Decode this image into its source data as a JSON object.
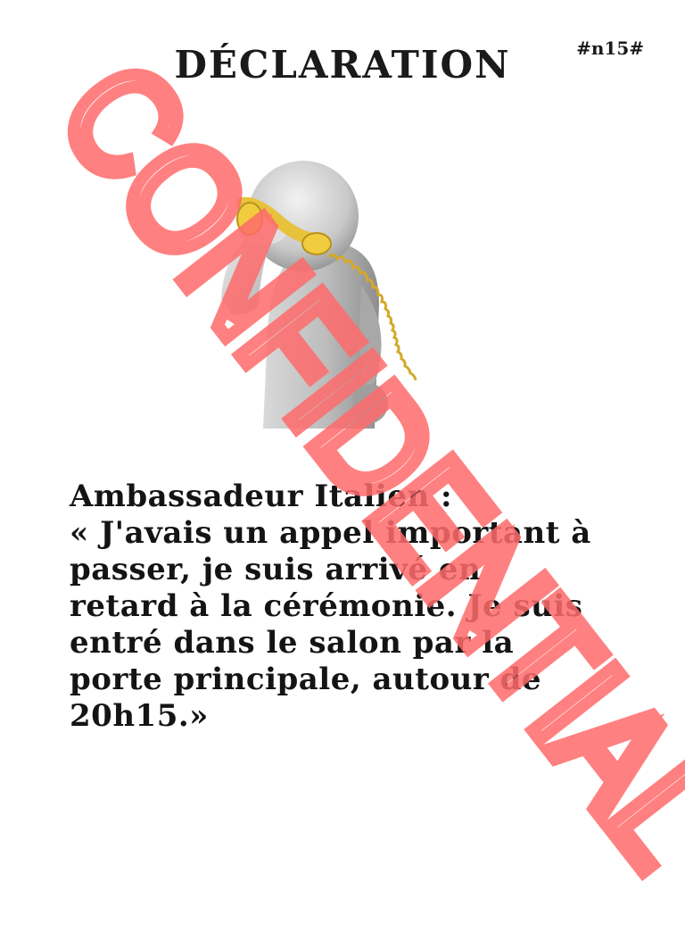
{
  "document": {
    "title": "DÉCLARATION",
    "code": "#n15#",
    "speaker": "Ambassadeur Italien :",
    "statement_lines": [
      "« J'avais un appel important à",
      "passer, je suis arrivé en",
      "retard à la cérémonie. Je suis",
      "entré dans le salon par la",
      "porte principale, autour de",
      "20h15.»"
    ],
    "watermark": "CONFIDENTIAL"
  },
  "colors": {
    "watermark": "#ff6b6b",
    "text": "#141414",
    "phone": "#e8c23a",
    "figure": "#bdbdbd"
  },
  "icons": {
    "illustration": "person-on-phone-icon"
  }
}
